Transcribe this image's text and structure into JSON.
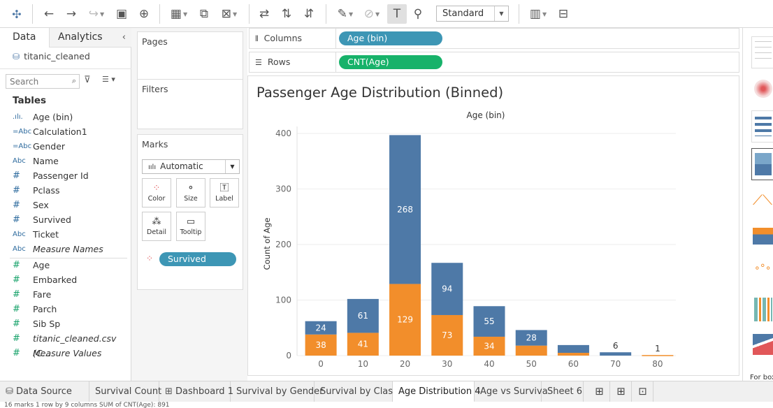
{
  "toolbar": {
    "standard_label": "Standard"
  },
  "left_panel": {
    "tab_data": "Data",
    "tab_analytics": "Analytics",
    "datasource": "titanic_cleaned",
    "search_placeholder": "Search",
    "tables_heading": "Tables",
    "dimensions": [
      {
        "icon": ".ılı.",
        "name": "Age (bin)"
      },
      {
        "icon": "=Abc",
        "name": "Calculation1"
      },
      {
        "icon": "=Abc",
        "name": "Gender"
      },
      {
        "icon": "Abc",
        "name": "Name"
      },
      {
        "icon": "#",
        "name": "Passenger Id"
      },
      {
        "icon": "#",
        "name": "Pclass"
      },
      {
        "icon": "#",
        "name": "Sex"
      },
      {
        "icon": "#",
        "name": "Survived"
      },
      {
        "icon": "Abc",
        "name": "Ticket"
      },
      {
        "icon": "Abc",
        "name": "Measure Names"
      }
    ],
    "measures": [
      {
        "icon": "#",
        "name": "Age"
      },
      {
        "icon": "#",
        "name": "Embarked"
      },
      {
        "icon": "#",
        "name": "Fare"
      },
      {
        "icon": "#",
        "name": "Parch"
      },
      {
        "icon": "#",
        "name": "Sib Sp"
      },
      {
        "icon": "#",
        "name": "titanic_cleaned.csv (C..."
      },
      {
        "icon": "#",
        "name": "Measure Values"
      }
    ]
  },
  "cards": {
    "pages": "Pages",
    "filters": "Filters",
    "marks": "Marks",
    "mark_type": "Automatic",
    "color": "Color",
    "size": "Size",
    "label": "Label",
    "detail": "Detail",
    "tooltip": "Tooltip",
    "color_pill": "Survived"
  },
  "shelves": {
    "columns_label": "Columns",
    "rows_label": "Rows",
    "columns_pill": "Age (bin)",
    "rows_pill": "CNT(Age)"
  },
  "colors": {
    "blue": "#4e79a7",
    "orange": "#f28e2b",
    "teal_pill": "#3d96b5",
    "green_pill": "#17b26a"
  },
  "chart_data": {
    "type": "bar",
    "title": "Passenger Age Distribution (Binned)",
    "column_header": "Age (bin)",
    "xlabel": "",
    "ylabel": "Count of Age",
    "categories": [
      "0",
      "10",
      "20",
      "30",
      "40",
      "50",
      "60",
      "70",
      "80"
    ],
    "series": [
      {
        "values": [
          38,
          41,
          129,
          73,
          34,
          18,
          5,
          0,
          1
        ],
        "labels": [
          "38",
          "41",
          "129",
          "73",
          "34",
          "",
          "",
          "",
          "1"
        ]
      },
      {
        "values": [
          24,
          61,
          268,
          94,
          55,
          28,
          14,
          6,
          0
        ],
        "labels": [
          "24",
          "61",
          "268",
          "94",
          "55",
          "28",
          "",
          "6",
          ""
        ]
      }
    ],
    "yticks": [
      0,
      100,
      200,
      300,
      400
    ],
    "ylim": [
      0,
      420
    ],
    "stacked": true,
    "grid": true
  },
  "bottom_tabs": [
    "Data Source",
    "Survival Count",
    "Dashboard 1",
    "Survival by Gender",
    "Survival by Class",
    "Age Distribution 4",
    "Age vs Surviva",
    "Sheet 6"
  ],
  "right_pane": {
    "footer": "For box"
  },
  "status": {
    "text": "16 marks   1 row by 9 columns   SUM of CNT(Age): 891"
  }
}
